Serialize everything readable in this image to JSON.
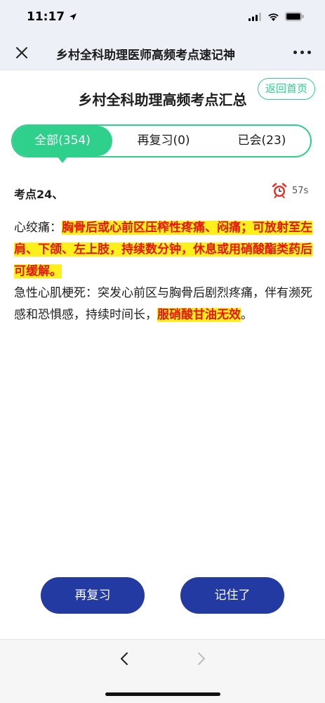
{
  "status": {
    "time": "11:17"
  },
  "nav": {
    "title": "乡村全科助理医师高频考点速记神"
  },
  "page": {
    "title": "乡村全科助理高频考点汇总",
    "home_label": "返回首页"
  },
  "tabs": [
    {
      "label": "全部(354)",
      "active": true
    },
    {
      "label": "再复习(0)",
      "active": false
    },
    {
      "label": "已会(23)",
      "active": false
    }
  ],
  "point": {
    "header": "考点24、",
    "timer": "57s"
  },
  "content": {
    "p1_prefix": "心绞痛：",
    "p1_highlight": "胸骨后或心前区压榨性疼痛、闷痛；可放射至左肩、下颌、左上肢，持续数分钟，休息或用硝酸酯类药后可缓解。",
    "p2_prefix": "急性心肌梗死：突发心前区与胸骨后剧烈疼痛，伴有濒死感和恐惧感，持续时间长，",
    "p2_highlight": "服硝酸甘油无效",
    "p2_suffix": "。"
  },
  "actions": {
    "review_label": "再复习",
    "remember_label": "记住了"
  },
  "colors": {
    "accent": "#2fcf8c",
    "primary": "#243aa3",
    "highlight_bg": "#ffef1a",
    "highlight_text": "#e8140f"
  }
}
